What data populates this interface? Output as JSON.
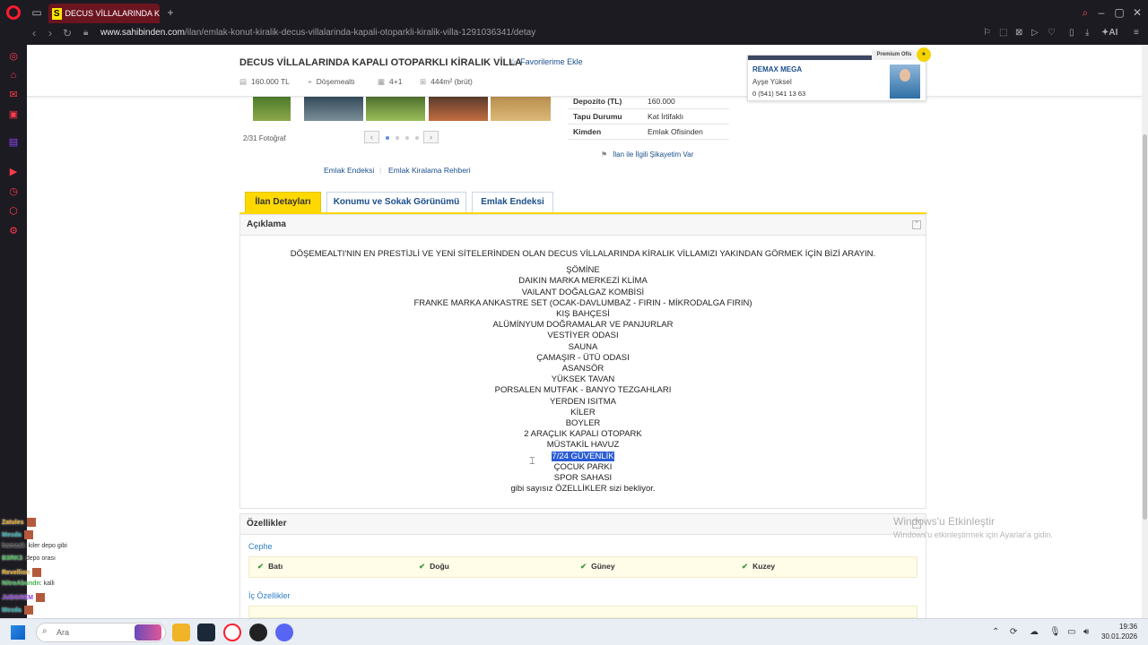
{
  "browser": {
    "tab_title": "DECUS VİLLALARINDA KAPALI",
    "favicon_letter": "S",
    "url_host": "www.sahibinden.com",
    "url_path": "/ilan/emlak-konut-kiralik-decus-villalarinda-kapali-otoparkli-kiralik-villa-1291036341/detay",
    "new_tab_label": "+"
  },
  "listing": {
    "title": "DECUS VİLLALARINDA KAPALI OTOPARKLI KİRALIK VİLLA",
    "favorite_label": "Favorilerime Ekle",
    "price": "160.000 TL",
    "location": "Döşemealtı",
    "rooms": "4+1",
    "area": "444m² (brüt)"
  },
  "agent": {
    "premium_label": "Premium Ofis",
    "office": "REMAX MEGA",
    "name": "Ayşe Yüksel",
    "phone": "0 (541) 541 13 63"
  },
  "gallery": {
    "count": "2/31 Fotoğraf",
    "prev": "‹",
    "next": "›"
  },
  "links": {
    "index": "Emlak Endeksi",
    "guide": "Emlak Kiralama Rehberi",
    "report": "İlan ile İlgili Şikayetim Var"
  },
  "details": [
    {
      "label": "Depozito (TL)",
      "value": "160.000"
    },
    {
      "label": "Tapu Durumu",
      "value": "Kat İrtifaklı"
    },
    {
      "label": "Kimden",
      "value": "Emlak Ofisinden"
    }
  ],
  "tabs": [
    "İlan Detayları",
    "Konumu ve Sokak Görünümü",
    "Emlak Endeksi"
  ],
  "description": {
    "heading": "Açıklama",
    "intro": "DÖŞEMEALTI'NIN EN PRESTİJLİ VE YENİ SİTELERİNDEN OLAN DECUS VİLLALARINDA KİRALIK VİLLAMIZI YAKINDAN GÖRMEK İÇİN BİZİ ARAYIN.",
    "lines": [
      "ŞÖMİNE",
      "DAIKIN MARKA MERKEZİ KLİMA",
      "VAILANT DOĞALGAZ KOMBİSİ",
      "FRANKE MARKA ANKASTRE SET (OCAK-DAVLUMBAZ - FIRIN - MİKRODALGA FIRIN)",
      "KIŞ BAHÇESİ",
      "ALÜMİNYUM DOĞRAMALAR VE PANJURLAR",
      "VESTİYER ODASI",
      "SAUNA",
      "ÇAMAŞIR - ÜTÜ ODASI",
      "ASANSÖR",
      "YÜKSEK TAVAN",
      "PORSALEN MUTFAK - BANYO TEZGAHLARI",
      "YERDEN ISITMA",
      "KİLER",
      "BOYLER",
      "2 ARAÇLIK KAPALI OTOPARK",
      "MÜSTAKİL HAVUZ",
      "7/24 GÜVENLİK",
      "ÇOCUK PARKI",
      "SPOR SAHASI",
      "gibi sayısız ÖZELLİKLER sizi bekliyor."
    ]
  },
  "features": {
    "heading": "Özellikler",
    "cephe_label": "Cephe",
    "cephe": [
      "Batı",
      "Doğu",
      "Güney",
      "Kuzey"
    ],
    "ic_label": "İç Özellikler"
  },
  "windows": {
    "activate_title": "Windows'u Etkinleştir",
    "activate_sub": "Windows'u etkinleştirmek için Ayarlar'a gidin.",
    "search_placeholder": "Ara",
    "time": "19:36",
    "date": "30.01.2026"
  },
  "chat": [
    {
      "user": "Zatules",
      "color": "#e0a020"
    },
    {
      "user": "Mesda",
      "color": "#20a0a0"
    },
    {
      "user": "hamzak",
      "color": "#333333",
      "msg": ": kiler depo gibi"
    },
    {
      "user": "B3RK3",
      "color": "#3cb44b",
      "msg": ": depo orası"
    },
    {
      "user": "Revellion",
      "color": "#e0a020"
    },
    {
      "user": "NitroAbundn",
      "color": "#3cb44b",
      "msg": ": kalli"
    },
    {
      "user": "JUDGREM",
      "color": "#8a3cd6"
    },
    {
      "user": "Mesda",
      "color": "#20a0a0"
    }
  ]
}
